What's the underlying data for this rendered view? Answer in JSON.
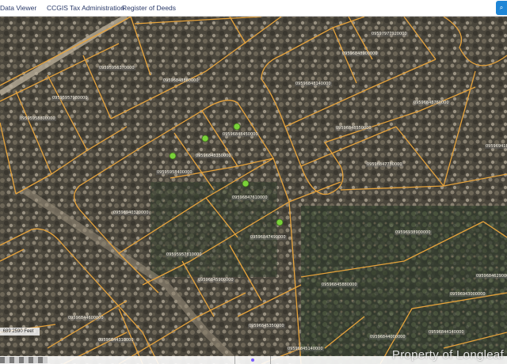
{
  "nav": {
    "items": [
      {
        "label": "Data Viewer"
      },
      {
        "label": "CCGIS"
      },
      {
        "label": "Tax Administration"
      },
      {
        "label": "Register of Deeds"
      }
    ],
    "action_icon": "search-icon"
  },
  "scale": {
    "text": ".689 2590 Feet"
  },
  "watermark": "Property of Longleaf",
  "parcel_labels": [
    "09597977920000",
    "09596848900000",
    "09595956370000",
    "09596848880000",
    "09596848140000",
    "09596848760000",
    "09595957980000",
    "09595958800000",
    "09596848550000",
    "09596941870000",
    "09596848450000",
    "09596848350000",
    "09595958400000",
    "09596847780000",
    "09596847610000",
    "09596940320000",
    "09596938900000",
    "09596847490000",
    "09595957810000",
    "09596846290000",
    "09596845900000",
    "09596845880000",
    "09596844600000",
    "09596845350000",
    "09596844310000",
    "09596844140000",
    "09596845140000",
    "09596844000000",
    "09596943000000"
  ],
  "colors": {
    "parcel_line": "#e8a43c",
    "pin": "#7bd23a",
    "nav_text": "#2a3a6a",
    "nav_button": "#1f86d6"
  }
}
